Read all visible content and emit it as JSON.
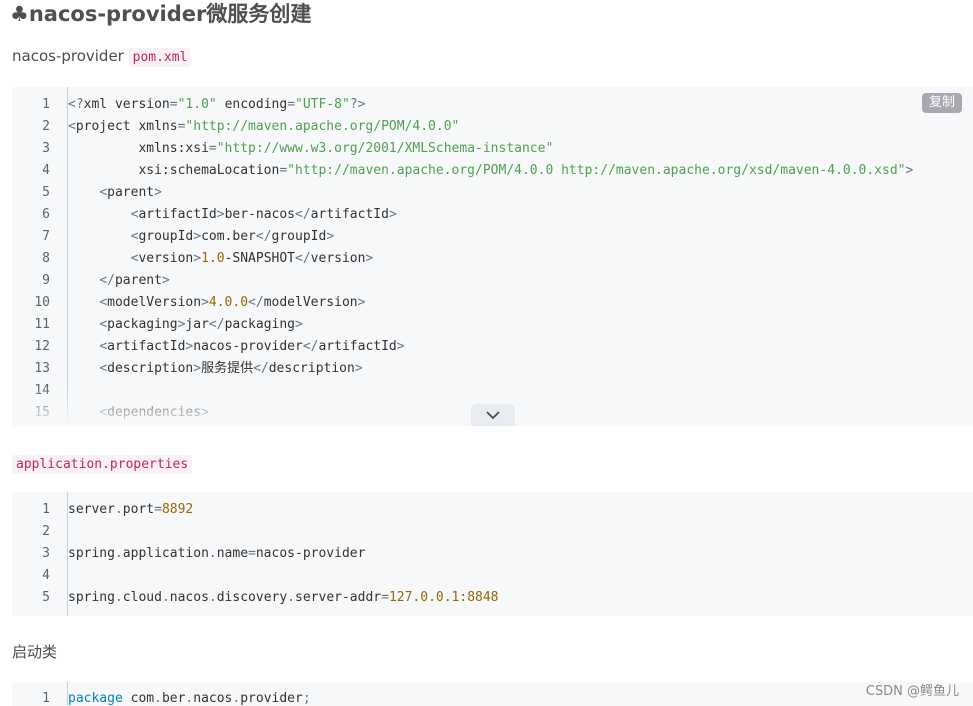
{
  "article": {
    "heading_icon": "clover-icon",
    "heading_text": "nacos-provider微服务创建",
    "para1_text": "nacos-provider ",
    "para1_code": "pom.xml",
    "para2_code": "application.properties",
    "para3_text": "启动类"
  },
  "pom_block": {
    "copy_label": "复制",
    "lines": [
      {
        "n": "1",
        "html": "<span class='t-br'>&lt;?</span><span class='t-tag'>xml</span> <span class='t-attr'>version</span><span class='t-br'>=</span><span class='t-str'>\"1.0\"</span> <span class='t-attr'>encoding</span><span class='t-br'>=</span><span class='t-str'>\"UTF-8\"</span><span class='t-br'>?&gt;</span>"
      },
      {
        "n": "2",
        "html": "<span class='t-br'>&lt;</span><span class='t-tag'>project</span> <span class='t-attr'>xmlns</span><span class='t-br'>=</span><span class='t-str'>\"http://maven.apache.org/POM/4.0.0\"</span>"
      },
      {
        "n": "3",
        "html": "         <span class='t-attr'>xmlns:xsi</span><span class='t-br'>=</span><span class='t-str'>\"http://www.w3.org/2001/XMLSchema-instance\"</span>"
      },
      {
        "n": "4",
        "html": "         <span class='t-attr'>xsi:schemaLocation</span><span class='t-br'>=</span><span class='t-str'>\"http://maven.apache.org/POM/4.0.0 http://maven.apache.org/xsd/maven-4.0.0.xsd\"</span><span class='t-br'>&gt;</span>"
      },
      {
        "n": "5",
        "html": "    <span class='t-br'>&lt;</span><span class='t-tag'>parent</span><span class='t-br'>&gt;</span>"
      },
      {
        "n": "6",
        "html": "        <span class='t-br'>&lt;</span><span class='t-tag'>artifactId</span><span class='t-br'>&gt;</span>ber-nacos<span class='t-br'>&lt;/</span><span class='t-tag'>artifactId</span><span class='t-br'>&gt;</span>"
      },
      {
        "n": "7",
        "html": "        <span class='t-br'>&lt;</span><span class='t-tag'>groupId</span><span class='t-br'>&gt;</span>com.ber<span class='t-br'>&lt;/</span><span class='t-tag'>groupId</span><span class='t-br'>&gt;</span>"
      },
      {
        "n": "8",
        "html": "        <span class='t-br'>&lt;</span><span class='t-tag'>version</span><span class='t-br'>&gt;</span><span class='t-num'>1.0</span>-SNAPSHOT<span class='t-br'>&lt;/</span><span class='t-tag'>version</span><span class='t-br'>&gt;</span>"
      },
      {
        "n": "9",
        "html": "    <span class='t-br'>&lt;/</span><span class='t-tag'>parent</span><span class='t-br'>&gt;</span>"
      },
      {
        "n": "10",
        "html": "    <span class='t-br'>&lt;</span><span class='t-tag'>modelVersion</span><span class='t-br'>&gt;</span><span class='t-num'>4.0.0</span><span class='t-br'>&lt;/</span><span class='t-tag'>modelVersion</span><span class='t-br'>&gt;</span>"
      },
      {
        "n": "11",
        "html": "    <span class='t-br'>&lt;</span><span class='t-tag'>packaging</span><span class='t-br'>&gt;</span>jar<span class='t-br'>&lt;/</span><span class='t-tag'>packaging</span><span class='t-br'>&gt;</span>"
      },
      {
        "n": "12",
        "html": "    <span class='t-br'>&lt;</span><span class='t-tag'>artifactId</span><span class='t-br'>&gt;</span>nacos-provider<span class='t-br'>&lt;/</span><span class='t-tag'>artifactId</span><span class='t-br'>&gt;</span>"
      },
      {
        "n": "13",
        "html": "    <span class='t-br'>&lt;</span><span class='t-tag'>description</span><span class='t-br'>&gt;</span>服务提供<span class='t-br'>&lt;/</span><span class='t-tag'>description</span><span class='t-br'>&gt;</span>"
      },
      {
        "n": "14",
        "html": ""
      },
      {
        "n": "15",
        "html": "    <span class='t-br'>&lt;</span><span class='t-tag'>dependencies</span><span class='t-br'>&gt;</span>"
      }
    ]
  },
  "props_block": {
    "lines": [
      {
        "n": "1",
        "html": "server<span class='t-br'>.</span>port<span class='t-br'>=</span><span class='t-num'>8892</span>"
      },
      {
        "n": "2",
        "html": ""
      },
      {
        "n": "3",
        "html": "spring<span class='t-br'>.</span>application<span class='t-br'>.</span>name<span class='t-br'>=</span>nacos-provider"
      },
      {
        "n": "4",
        "html": ""
      },
      {
        "n": "5",
        "html": "spring<span class='t-br'>.</span>cloud<span class='t-br'>.</span>nacos<span class='t-br'>.</span>discovery<span class='t-br'>.</span>server-addr<span class='t-br'>=</span><span class='t-num'>127.0.0.1:8848</span>"
      }
    ]
  },
  "java_block": {
    "lines": [
      {
        "n": "1",
        "html": "<span class='t-kw'>package</span> com<span class='t-br'>.</span>ber<span class='t-br'>.</span>nacos<span class='t-br'>.</span>provider<span class='t-br'>;</span>"
      }
    ]
  },
  "watermark": "CSDN @鳄鱼儿"
}
